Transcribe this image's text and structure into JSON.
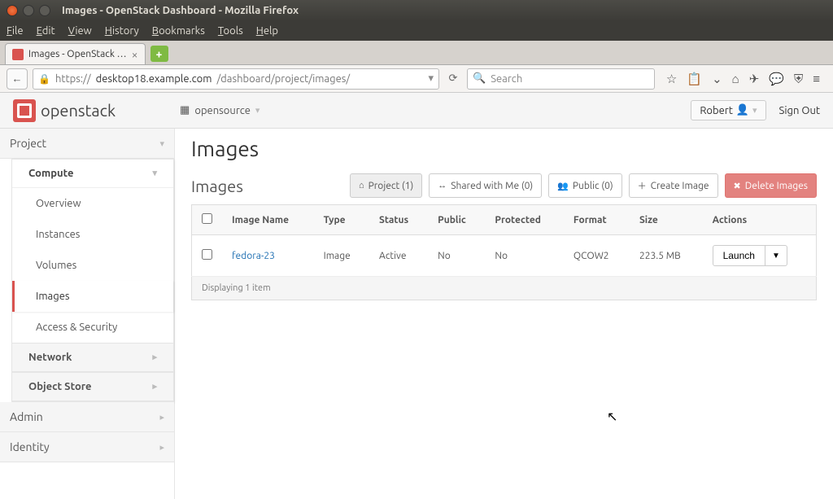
{
  "window": {
    "title": "Images - OpenStack Dashboard - Mozilla Firefox"
  },
  "menubar": [
    "File",
    "Edit",
    "View",
    "History",
    "Bookmarks",
    "Tools",
    "Help"
  ],
  "tab": {
    "label": "Images - OpenStack …"
  },
  "url": {
    "scheme": "https://",
    "host": "desktop18.example.com",
    "path": "/dashboard/project/images/"
  },
  "search_placeholder": "Search",
  "topbar": {
    "brand": "openstack",
    "domain": "opensource",
    "user": "Robert",
    "signout": "Sign Out"
  },
  "sidebar": {
    "project": "Project",
    "compute": "Compute",
    "items": [
      "Overview",
      "Instances",
      "Volumes",
      "Images",
      "Access & Security"
    ],
    "network": "Network",
    "object_store": "Object Store",
    "admin": "Admin",
    "identity": "Identity"
  },
  "page": {
    "title": "Images",
    "panel_title": "Images",
    "filters": {
      "project": "Project (1)",
      "shared": "Shared with Me (0)",
      "public": "Public (0)"
    },
    "create_btn": "Create Image",
    "delete_btn": "Delete Images",
    "columns": [
      "",
      "Image Name",
      "Type",
      "Status",
      "Public",
      "Protected",
      "Format",
      "Size",
      "Actions"
    ],
    "rows": [
      {
        "name": "fedora-23",
        "type": "Image",
        "status": "Active",
        "public": "No",
        "protected": "No",
        "format": "QCOW2",
        "size": "223.5 MB",
        "action": "Launch"
      }
    ],
    "footer": "Displaying 1 item"
  }
}
